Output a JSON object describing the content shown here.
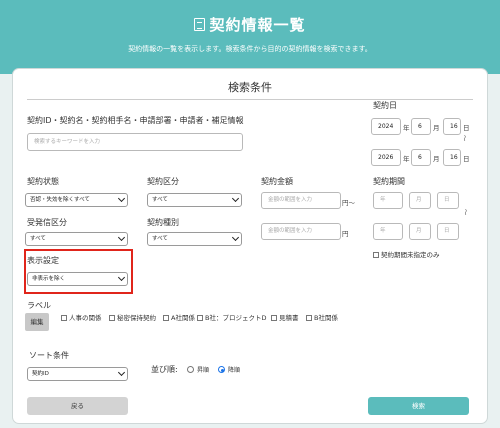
{
  "header": {
    "title": "契約情報一覧",
    "subtitle": "契約情報の一覧を表示します。検索条件から目的の契約情報を検索できます。"
  },
  "card": {
    "title": "検索条件"
  },
  "keyword": {
    "label": "契約ID・契約名・契約相手名・申請部署・申請者・補足情報",
    "placeholder": "検索するキーワードを入力"
  },
  "contract_date": {
    "label": "契約日",
    "from": {
      "year": "2024",
      "month": "6",
      "day": "16"
    },
    "to": {
      "year": "2026",
      "month": "6",
      "day": "16"
    },
    "year_unit": "年",
    "month_unit": "月",
    "day_unit": "日",
    "range_mark": "〜"
  },
  "status": {
    "label": "契約状態",
    "value": "否認・失効を除くすべて"
  },
  "category": {
    "label": "契約区分",
    "value": "すべて"
  },
  "amount": {
    "label": "契約金額",
    "from_placeholder": "金額の範囲を入力",
    "to_placeholder": "金額の範囲を入力",
    "unit_from": "円〜",
    "unit_to": "円"
  },
  "period": {
    "label": "契約期間",
    "year_ph": "年",
    "month_ph": "月",
    "day_ph": "日",
    "range_mark": "〜",
    "unspecified_label": "契約期間未指定のみ"
  },
  "send_receive": {
    "label": "受発信区分",
    "value": "すべて"
  },
  "contract_type": {
    "label": "契約種別",
    "value": "すべて"
  },
  "display_setting": {
    "label": "表示設定",
    "value": "非表示を除く"
  },
  "labels": {
    "label": "ラベル",
    "edit_button": "編集",
    "items": [
      "人事の関係",
      "秘密保持契約",
      "A社関係",
      "B社：プロジェクトD",
      "見積書",
      "B社関係"
    ]
  },
  "sort": {
    "label": "ソート条件",
    "value": "契約ID",
    "order_label": "並び順:",
    "asc": "昇順",
    "desc": "降順",
    "selected": "desc"
  },
  "buttons": {
    "back": "戻る",
    "search": "検索"
  },
  "colors": {
    "accent": "#5bbcbc",
    "highlight": "#e0251b",
    "radio": "#1a73e8"
  }
}
